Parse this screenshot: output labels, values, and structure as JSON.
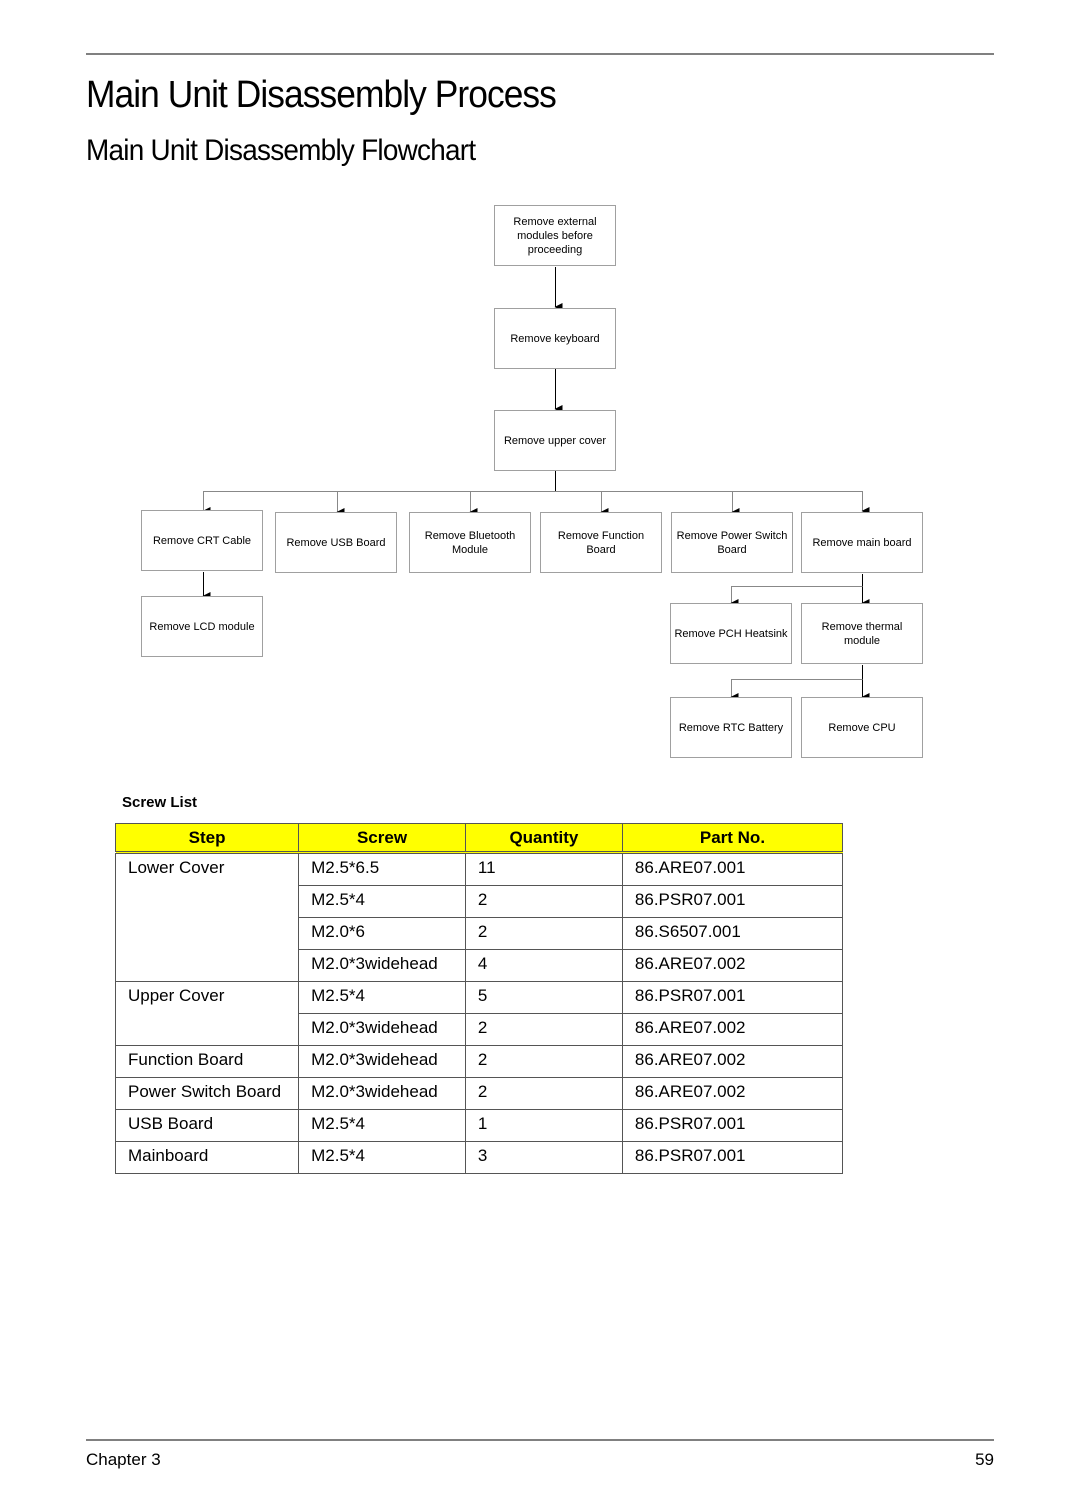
{
  "page": {
    "title": "Main Unit Disassembly Process",
    "section_title": "Main Unit Disassembly Flowchart"
  },
  "flowchart": {
    "nodes": {
      "external": "Remove external modules before proceeding",
      "keyboard": "Remove keyboard",
      "upper_cover": "Remove upper cover",
      "crt_cable": "Remove CRT Cable",
      "usb_board": "Remove USB Board",
      "bluetooth": "Remove Bluetooth Module",
      "function_board": "Remove Function Board",
      "power_switch": "Remove Power Switch Board",
      "main_board": "Remove main board",
      "lcd_module": "Remove LCD module",
      "pch_heatsink": "Remove PCH Heatsink",
      "thermal_module": "Remove thermal module",
      "rtc_battery": "Remove RTC Battery",
      "cpu": "Remove CPU"
    },
    "edges": [
      [
        "external",
        "keyboard"
      ],
      [
        "keyboard",
        "upper_cover"
      ],
      [
        "upper_cover",
        "crt_cable"
      ],
      [
        "upper_cover",
        "usb_board"
      ],
      [
        "upper_cover",
        "bluetooth"
      ],
      [
        "upper_cover",
        "function_board"
      ],
      [
        "upper_cover",
        "power_switch"
      ],
      [
        "upper_cover",
        "main_board"
      ],
      [
        "crt_cable",
        "lcd_module"
      ],
      [
        "main_board",
        "pch_heatsink"
      ],
      [
        "main_board",
        "thermal_module"
      ],
      [
        "thermal_module",
        "rtc_battery"
      ],
      [
        "thermal_module",
        "cpu"
      ]
    ]
  },
  "screw_list": {
    "label": "Screw List",
    "headers": [
      "Step",
      "Screw",
      "Quantity",
      "Part No."
    ],
    "groups": [
      {
        "step": "Lower Cover",
        "rows": [
          {
            "screw": "M2.5*6.5",
            "quantity": "11",
            "part_no": "86.ARE07.001"
          },
          {
            "screw": "M2.5*4",
            "quantity": "2",
            "part_no": "86.PSR07.001"
          },
          {
            "screw": "M2.0*6",
            "quantity": "2",
            "part_no": "86.S6507.001"
          },
          {
            "screw": "M2.0*3widehead",
            "quantity": "4",
            "part_no": "86.ARE07.002"
          }
        ]
      },
      {
        "step": "Upper Cover",
        "rows": [
          {
            "screw": "M2.5*4",
            "quantity": "5",
            "part_no": "86.PSR07.001"
          },
          {
            "screw": "M2.0*3widehead",
            "quantity": "2",
            "part_no": "86.ARE07.002"
          }
        ]
      },
      {
        "step": "Function Board",
        "rows": [
          {
            "screw": "M2.0*3widehead",
            "quantity": "2",
            "part_no": "86.ARE07.002"
          }
        ]
      },
      {
        "step": "Power Switch Board",
        "rows": [
          {
            "screw": "M2.0*3widehead",
            "quantity": "2",
            "part_no": "86.ARE07.002"
          }
        ]
      },
      {
        "step": "USB Board",
        "rows": [
          {
            "screw": "M2.5*4",
            "quantity": "1",
            "part_no": "86.PSR07.001"
          }
        ]
      },
      {
        "step": "Mainboard",
        "rows": [
          {
            "screw": "M2.5*4",
            "quantity": "3",
            "part_no": "86.PSR07.001"
          }
        ]
      }
    ]
  },
  "footer": {
    "chapter": "Chapter 3",
    "page_number": "59"
  }
}
